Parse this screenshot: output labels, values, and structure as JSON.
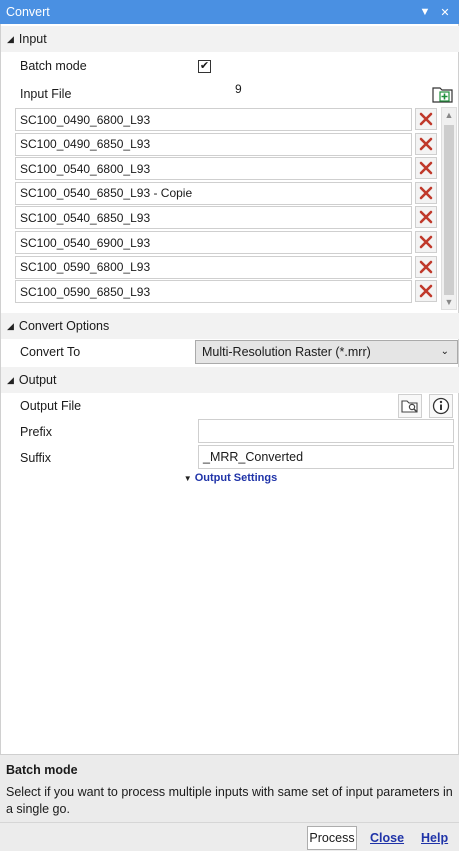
{
  "window": {
    "title": "Convert",
    "menu_glyph": "▼",
    "close_glyph": "✕"
  },
  "sections": {
    "input": {
      "label": "Input"
    },
    "convert_options": {
      "label": "Convert Options"
    },
    "output": {
      "label": "Output"
    }
  },
  "input": {
    "batch_mode_label": "Batch mode",
    "batch_mode_checked": true,
    "input_file_label": "Input File",
    "file_count": "9",
    "files": [
      "SC100_0490_6800_L93",
      "SC100_0490_6850_L93",
      "SC100_0540_6800_L93",
      "SC100_0540_6850_L93 - Copie",
      "SC100_0540_6850_L93",
      "SC100_0540_6900_L93",
      "SC100_0590_6800_L93",
      "SC100_0590_6850_L93"
    ]
  },
  "convert_options": {
    "convert_to_label": "Convert To",
    "convert_to_value": "Multi-Resolution Raster (*.mrr)"
  },
  "output": {
    "output_file_label": "Output File",
    "prefix_label": "Prefix",
    "prefix_value": "",
    "suffix_label": "Suffix",
    "suffix_value": "_MRR_Converted",
    "output_settings_label": "Output Settings"
  },
  "help": {
    "title": "Batch mode",
    "description": "Select if you want to process multiple inputs with same set of input parameters in a single go."
  },
  "footer": {
    "process": "Process",
    "close": "Close",
    "help": "Help"
  },
  "colors": {
    "titlebar": "#4a90e2",
    "link": "#1f33a8",
    "delete_x": "#c0392b"
  }
}
